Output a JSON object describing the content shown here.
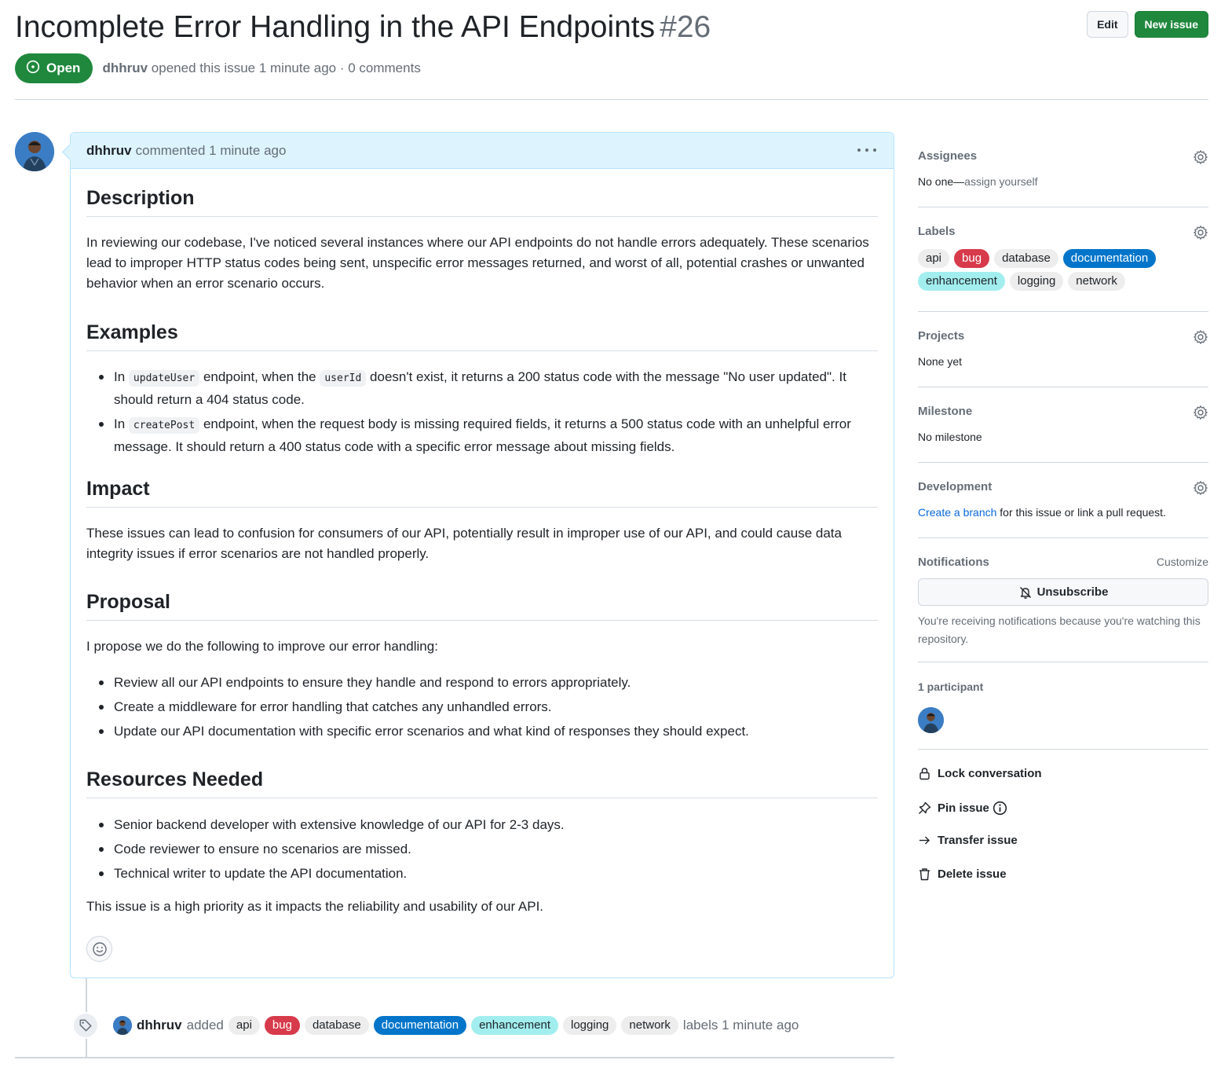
{
  "issue": {
    "title": "Incomplete Error Handling in the API Endpoints",
    "number": "#26",
    "state": "Open",
    "author": "dhhruv",
    "opened_text": "opened this issue 1 minute ago · 0 comments"
  },
  "header_actions": {
    "edit_label": "Edit",
    "new_issue_label": "New issue"
  },
  "comment": {
    "author": "dhhruv",
    "meta": "commented 1 minute ago",
    "sections": {
      "description": {
        "heading": "Description",
        "text": "In reviewing our codebase, I've noticed several instances where our API endpoints do not handle errors adequately. These scenarios lead to improper HTTP status codes being sent, unspecific error messages returned, and worst of all, potential crashes or unwanted behavior when an error scenario occurs."
      },
      "examples": {
        "heading": "Examples",
        "item1": {
          "prefix": "In",
          "code1": "updateUser",
          "mid1": "endpoint, when the",
          "code2": "userId",
          "rest": "doesn't exist, it returns a 200 status code with the message \"No user updated\". It should return a 404 status code."
        },
        "item2": {
          "prefix": "In",
          "code1": "createPost",
          "rest": "endpoint, when the request body is missing required fields, it returns a 500 status code with an unhelpful error message. It should return a 400 status code with a specific error message about missing fields."
        }
      },
      "impact": {
        "heading": "Impact",
        "text": "These issues can lead to confusion for consumers of our API, potentially result in improper use of our API, and could cause data integrity issues if error scenarios are not handled properly."
      },
      "proposal": {
        "heading": "Proposal",
        "intro": "I propose we do the following to improve our error handling:",
        "items": [
          "Review all our API endpoints to ensure they handle and respond to errors appropriately.",
          "Create a middleware for error handling that catches any unhandled errors.",
          "Update our API documentation with specific error scenarios and what kind of responses they should expect."
        ]
      },
      "resources": {
        "heading": "Resources Needed",
        "items": [
          "Senior backend developer with extensive knowledge of our API for 2-3 days.",
          "Code reviewer to ensure no scenarios are missed.",
          "Technical writer to update the API documentation."
        ],
        "closing": "This issue is a high priority as it impacts the reliability and usability of our API."
      }
    }
  },
  "labels": [
    "api",
    "bug",
    "database",
    "documentation",
    "enhancement",
    "logging",
    "network"
  ],
  "label_colors": {
    "api": "#ededed",
    "bug": "#d73a4a",
    "database": "#ededed",
    "documentation": "#0075ca",
    "enhancement": "#a2eeef",
    "logging": "#ededed",
    "network": "#ededed"
  },
  "event": {
    "author": "dhhruv",
    "action": "added",
    "suffix": "labels 1 minute ago"
  },
  "sidebar": {
    "assignees": {
      "title": "Assignees",
      "value_prefix": "No one—",
      "value_link": "assign yourself"
    },
    "labels": {
      "title": "Labels"
    },
    "projects": {
      "title": "Projects",
      "value": "None yet"
    },
    "milestone": {
      "title": "Milestone",
      "value": "No milestone"
    },
    "development": {
      "title": "Development",
      "link": "Create a branch",
      "rest": "for this issue or link a pull request."
    },
    "notifications": {
      "title": "Notifications",
      "customize": "Customize",
      "button": "Unsubscribe",
      "note": "You're receiving notifications because you're watching this repository."
    },
    "participants": {
      "title": "1 participant"
    },
    "actions": {
      "lock": "Lock conversation",
      "pin": "Pin issue",
      "transfer": "Transfer issue",
      "delete": "Delete issue"
    }
  },
  "colors": {
    "primary_green": "#1f883d",
    "link_blue": "#0969da",
    "comment_header_bg": "#ddf4ff",
    "comment_border": "#b6e3ff"
  }
}
